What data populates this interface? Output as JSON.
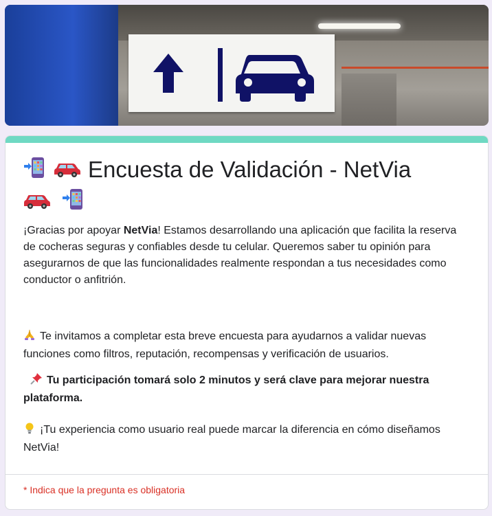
{
  "header": {
    "banner_icons": [
      "up-arrow-icon",
      "car-icon"
    ]
  },
  "form": {
    "title_emojis": [
      "mobile-phone-arrow-icon",
      "car-icon",
      "car-icon",
      "mobile-phone-arrow-icon"
    ],
    "title": "Encuesta de Validación - NetVia",
    "description": {
      "p1_prefix": "¡Gracias por apoyar ",
      "p1_brand": "NetVia",
      "p1_rest": "! Estamos desarrollando una aplicación que facilita la reserva de cocheras seguras y confiables desde tu celular. Queremos saber tu opinión para asegurarnos de que las funcionalidades realmente respondan a tus necesidades como conductor o anfitrión.",
      "p2": "Te invitamos a completar esta breve encuesta para ayudarnos a validar nuevas funciones como filtros, reputación, recompensas y verificación de usuarios.",
      "p3": "Tu participación tomará solo 2 minutos y será clave para mejorar nuestra plataforma.",
      "p4": "¡Tu experiencia como usuario real puede marcar la diferencia en cómo diseñamos NetVia!"
    },
    "required_note": "* Indica que la pregunta es obligatoria"
  },
  "colors": {
    "accent": "#6fd9c3",
    "required": "#d93025",
    "sign_blue": "#101266",
    "background": "#f0ebf8"
  }
}
